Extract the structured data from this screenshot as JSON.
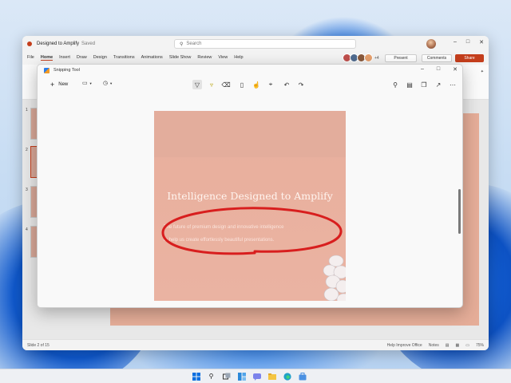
{
  "ppt": {
    "doc_title": "Designed to Amplify",
    "saved": "Saved",
    "search_placeholder": "Search",
    "tabs": [
      "File",
      "Home",
      "Insert",
      "Draw",
      "Design",
      "Transitions",
      "Animations",
      "Slide Show",
      "Review",
      "View",
      "Help"
    ],
    "collab_more": "+4",
    "present_label": "Present",
    "comments_label": "Comments",
    "share_label": "Share",
    "thumb_numbers": [
      "1",
      "2",
      "3",
      "4"
    ],
    "status_left": "Slide 2 of 15",
    "status_help": "Help Improve Office",
    "status_notes": "Notes",
    "status_zoom": "75%"
  },
  "snip": {
    "title": "Snipping Tool",
    "new_label": "New"
  },
  "slide": {
    "headline": "Intelligence Designed to Amplify",
    "sub1": "The future of premium design and innovative intelligence",
    "sub2": "to help us create effortlessly beautiful presentations."
  },
  "colors": {
    "accent": "#c43e1c",
    "annotation": "#d81e1e",
    "slide_bg": "#e8b09e"
  }
}
